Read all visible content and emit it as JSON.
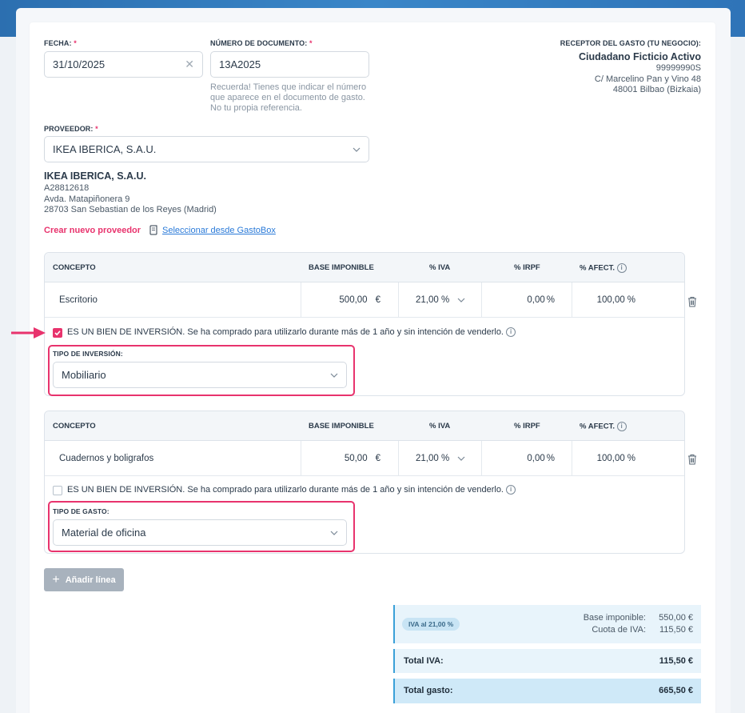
{
  "header": {
    "fecha_label": "FECHA:",
    "fecha_value": "31/10/2025",
    "doc_label": "NÚMERO DE DOCUMENTO:",
    "doc_value": "13A2025",
    "required_mark": "*",
    "doc_hint": [
      "Recuerda! Tienes que indicar el número",
      "que aparece en el documento de gasto.",
      "No tu propia referencia."
    ]
  },
  "receptor": {
    "label": "RECEPTOR DEL GASTO (TU NEGOCIO):",
    "name": "Ciudadano Ficticio Activo",
    "nif": "99999990S",
    "address": "C/ Marcelino Pan y Vino 48",
    "city": "48001 Bilbao (Bizkaia)"
  },
  "proveedor": {
    "label": "PROVEEDOR:",
    "selected": "IKEA IBERICA, S.A.U.",
    "name": "IKEA IBERICA, S.A.U.",
    "nif": "A28812618",
    "address": "Avda. Matapiñonera 9",
    "city": "28703 San Sebastian de los Reyes (Madrid)",
    "create_link": "Crear nuevo proveedor",
    "select_link": "Seleccionar desde GastoBox"
  },
  "table_headers": {
    "concepto": "CONCEPTO",
    "base": "BASE IMPONIBLE",
    "iva": "% IVA",
    "irpf": "% IRPF",
    "afect": "% AFECT."
  },
  "lines": [
    {
      "concepto": "Escritorio",
      "base": "500,00",
      "currency": "€",
      "iva": "21,00 %",
      "irpf": "0,00",
      "afect": "100,00",
      "pct": "%",
      "investment_checked": true,
      "investment_text": "ES UN BIEN DE INVERSIÓN. Se ha comprado para utilizarlo durante más de 1 año y sin intención de venderlo.",
      "type_label": "TIPO DE INVERSIÓN:",
      "type_value": "Mobiliario"
    },
    {
      "concepto": "Cuadernos y boligrafos",
      "base": "50,00",
      "currency": "€",
      "iva": "21,00 %",
      "irpf": "0,00",
      "afect": "100,00",
      "pct": "%",
      "investment_checked": false,
      "investment_text": "ES UN BIEN DE INVERSIÓN. Se ha comprado para utilizarlo durante más de 1 año y sin intención de venderlo.",
      "type_label": "TIPO DE GASTO:",
      "type_value": "Material de oficina"
    }
  ],
  "add_line": "Añadir línea",
  "summary": {
    "badge": "IVA al 21,00 %",
    "base_label": "Base imponible:",
    "base_value": "550,00 €",
    "cuota_label": "Cuota de IVA:",
    "cuota_value": "115,50 €",
    "total_iva_label": "Total IVA:",
    "total_iva_value": "115,50 €",
    "total_gasto_label": "Total gasto:",
    "total_gasto_value": "665,50 €"
  },
  "icons": [
    "clear-icon",
    "chevron-down-icon",
    "document-icon",
    "info-icon",
    "trash-icon",
    "plus-icon",
    "arrow-right-icon"
  ],
  "colors": {
    "accent": "#e8336d",
    "link": "#2a7ad8",
    "header_band": "#3a86c8",
    "summary_bg": "#e8f4fb"
  }
}
